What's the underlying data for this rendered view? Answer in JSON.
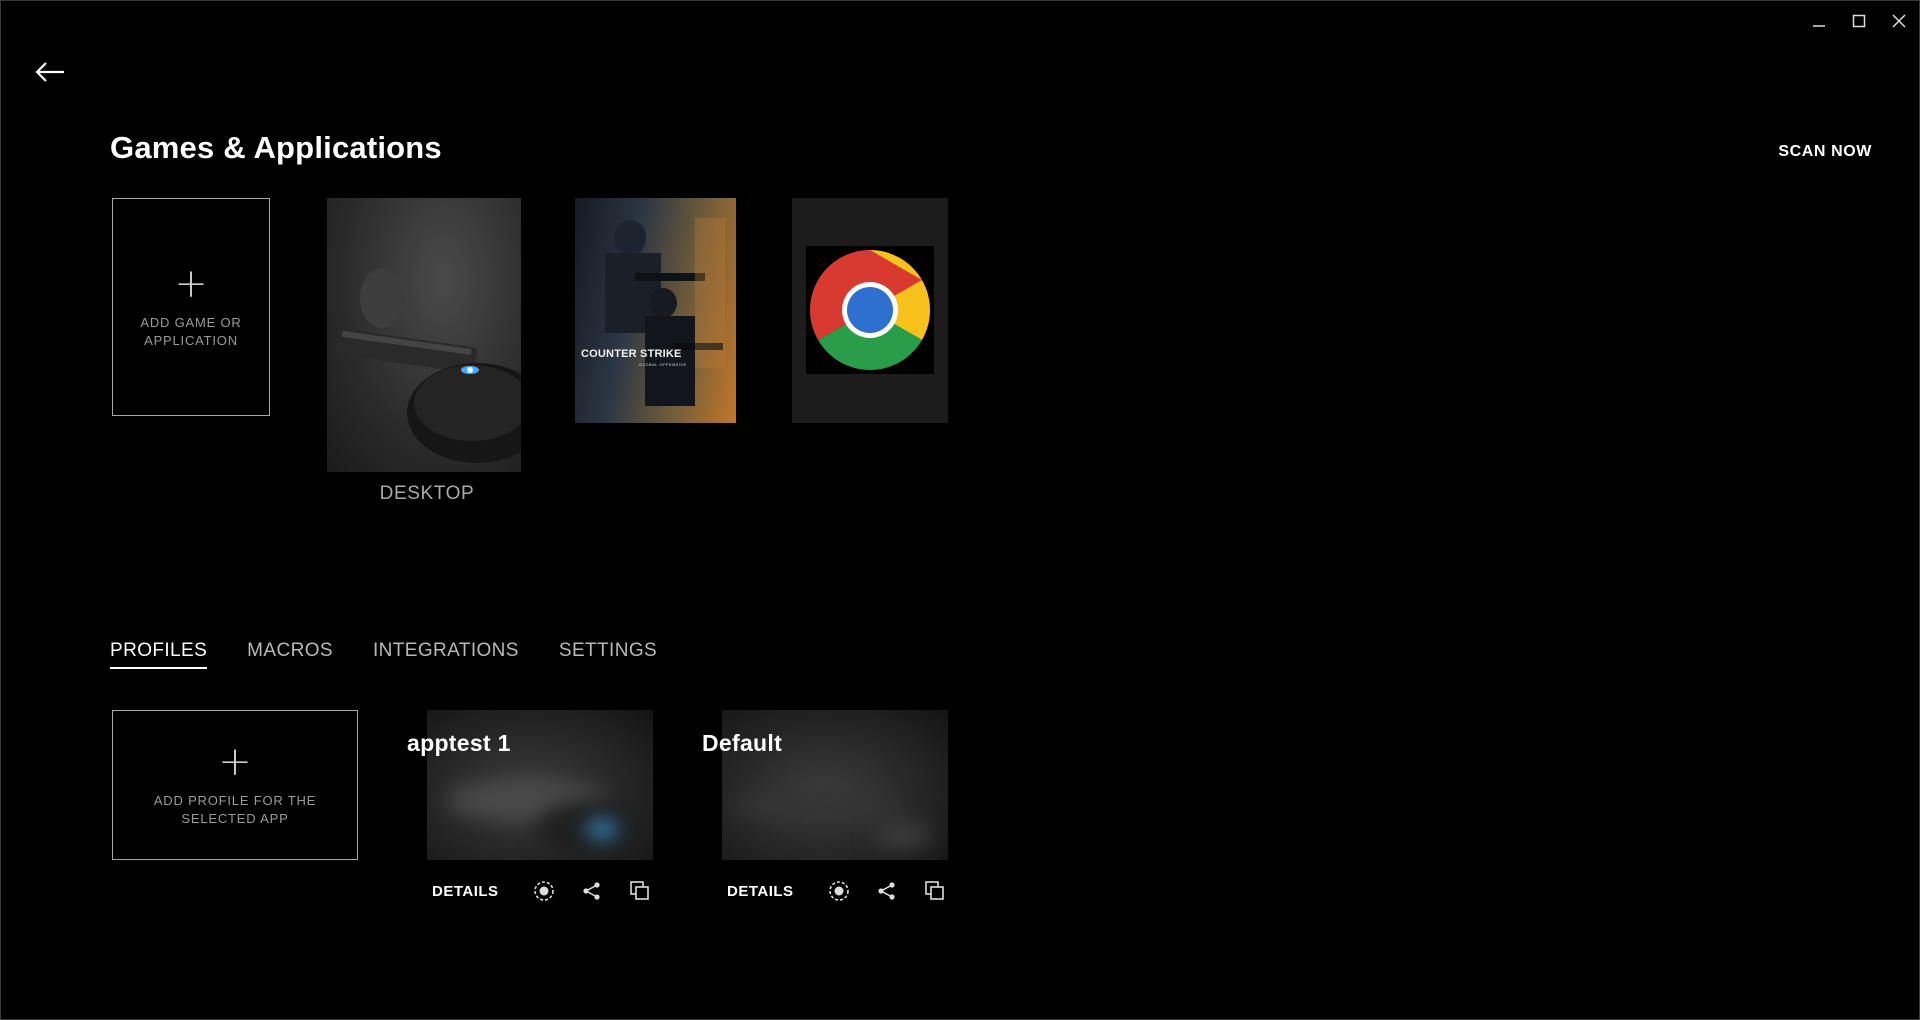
{
  "window": {
    "minimize_icon": "minimize-icon",
    "maximize_icon": "maximize-icon",
    "close_icon": "close-icon"
  },
  "header": {
    "back_icon": "back-arrow-icon",
    "title": "Games & Applications",
    "scan_label": "SCAN NOW"
  },
  "games": {
    "add_label": "ADD GAME OR APPLICATION",
    "desktop_label": "DESKTOP",
    "cs_logo_text": "COUNTER STRIKE",
    "cs_sub_text": "GLOBAL OFFENSIVE"
  },
  "tabs": [
    {
      "label": "PROFILES",
      "active": true
    },
    {
      "label": "MACROS",
      "active": false
    },
    {
      "label": "INTEGRATIONS",
      "active": false
    },
    {
      "label": "SETTINGS",
      "active": false
    }
  ],
  "profiles": {
    "add_label": "ADD PROFILE FOR THE SELECTED APP",
    "items": [
      {
        "name": "apptest 1",
        "details_label": "DETAILS"
      },
      {
        "name": "Default",
        "details_label": "DETAILS"
      }
    ]
  },
  "colors": {
    "background": "#000000",
    "accent_blue": "#4aa9ff",
    "muted_text": "#9a9a9a"
  }
}
